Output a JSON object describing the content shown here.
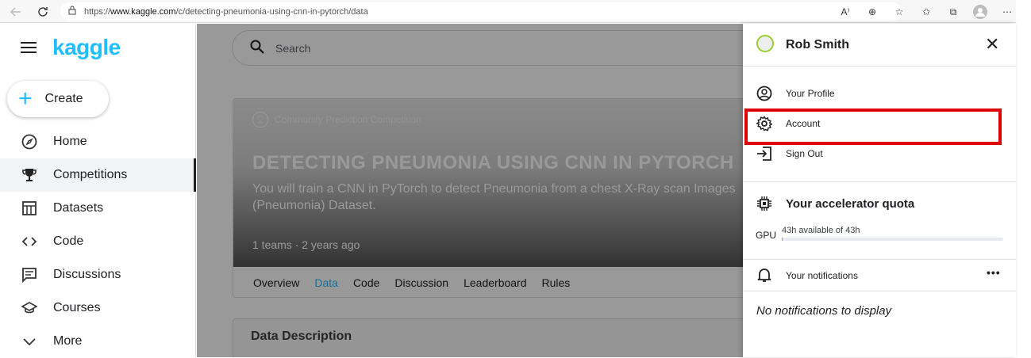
{
  "browser": {
    "url_prefix": "https://",
    "url_host": "www.kaggle.com",
    "url_path": "/c/detecting-pneumonia-using-cnn-in-pytorch/data"
  },
  "sidebar": {
    "logo": "kaggle",
    "create_label": "Create",
    "items": [
      {
        "label": "Home",
        "icon": "compass-icon"
      },
      {
        "label": "Competitions",
        "icon": "trophy-icon",
        "active": true
      },
      {
        "label": "Datasets",
        "icon": "table-icon"
      },
      {
        "label": "Code",
        "icon": "code-icon"
      },
      {
        "label": "Discussions",
        "icon": "comment-icon"
      },
      {
        "label": "Courses",
        "icon": "school-icon"
      },
      {
        "label": "More",
        "icon": "chevron-down-icon"
      }
    ]
  },
  "main": {
    "search_placeholder": "Search",
    "competition": {
      "type": "Community Prediction Competition",
      "title": "DETECTING PNEUMONIA USING CNN IN PYTORCH",
      "description": "You will train a CNN in PyTorch to detect Pneumonia from a chest X-Ray scan Images (Pneumonia) Dataset.",
      "meta": "1 teams · 2 years ago"
    },
    "tabs": [
      "Overview",
      "Data",
      "Code",
      "Discussion",
      "Leaderboard",
      "Rules"
    ],
    "active_tab": "Data",
    "section_title": "Data Description"
  },
  "panel": {
    "username": "Rob Smith",
    "menu": [
      {
        "label": "Your Profile",
        "icon": "account-circle-icon"
      },
      {
        "label": "Account",
        "icon": "gear-icon",
        "highlighted": true
      },
      {
        "label": "Sign Out",
        "icon": "sign-out-icon"
      }
    ],
    "quota_title": "Your accelerator quota",
    "gpu_label": "GPU",
    "gpu_text": "43h available of 43h",
    "gpu_fraction": 0.005,
    "notifications_label": "Your notifications",
    "no_notifications": "No notifications to display"
  },
  "colors": {
    "accent": "#20beff",
    "highlight": "#e00000"
  }
}
